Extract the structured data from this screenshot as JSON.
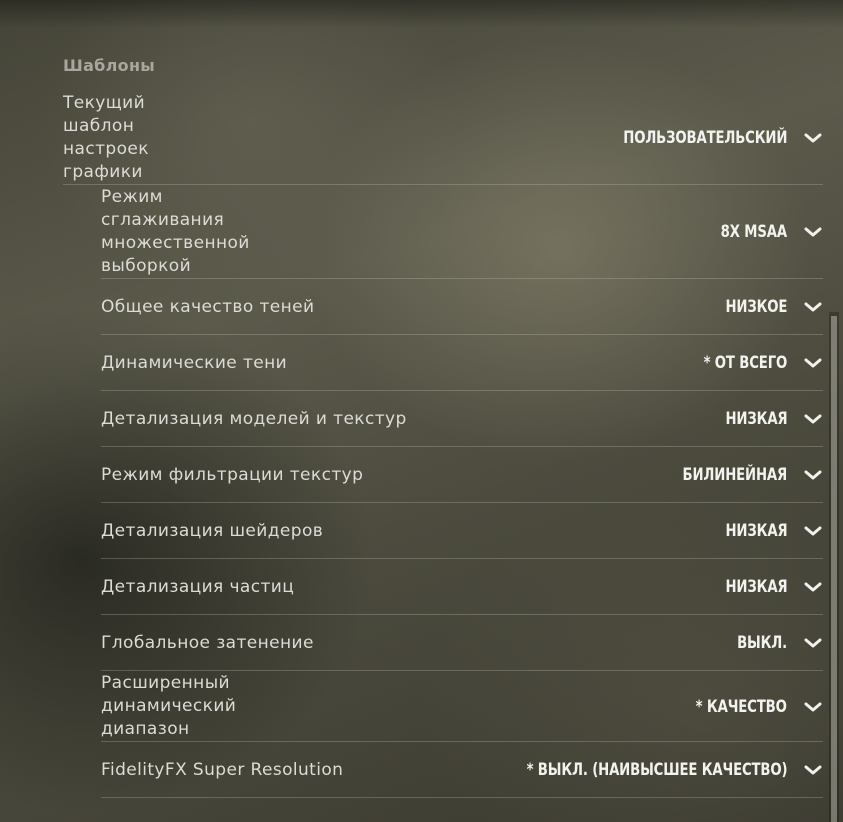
{
  "section": {
    "title": "Шаблоны"
  },
  "settings": [
    {
      "label": "Текущий\nшаблон\nнастроек\nграфики",
      "value": "ПОЛЬЗОВАТЕЛЬСКИЙ",
      "icon": "chevron-down-icon"
    },
    {
      "label": "Режим\nсглаживания\nмножественной\nвыборкой",
      "value": "8X MSAA",
      "icon": "chevron-down-icon"
    },
    {
      "label": "Общее качество теней",
      "value": "НИЗКОЕ",
      "icon": "chevron-down-icon"
    },
    {
      "label": "Динамические тени",
      "value": "* ОТ ВСЕГО",
      "icon": "chevron-down-icon"
    },
    {
      "label": "Детализация моделей и текстур",
      "value": "НИЗКАЯ",
      "icon": "chevron-down-icon"
    },
    {
      "label": "Режим фильтрации текстур",
      "value": "БИЛИНЕЙНАЯ",
      "icon": "chevron-down-icon"
    },
    {
      "label": "Детализация шейдеров",
      "value": "НИЗКАЯ",
      "icon": "chevron-down-icon"
    },
    {
      "label": "Детализация частиц",
      "value": "НИЗКАЯ",
      "icon": "chevron-down-icon"
    },
    {
      "label": "Глобальное затенение",
      "value": "ВЫКЛ.",
      "icon": "chevron-down-icon"
    },
    {
      "label": "Расширенный\nдинамический\nдиапазон",
      "value": "* КАЧЕСТВО",
      "icon": "chevron-down-icon"
    },
    {
      "label": "FidelityFX Super Resolution",
      "value": "* ВЫКЛ. (НАИВЫСШЕЕ КАЧЕСТВО)",
      "icon": "chevron-down-icon"
    }
  ],
  "colors": {
    "text": "#dcdcd6",
    "value_text": "#f2f2ee",
    "section_title": "#a7a79d"
  }
}
